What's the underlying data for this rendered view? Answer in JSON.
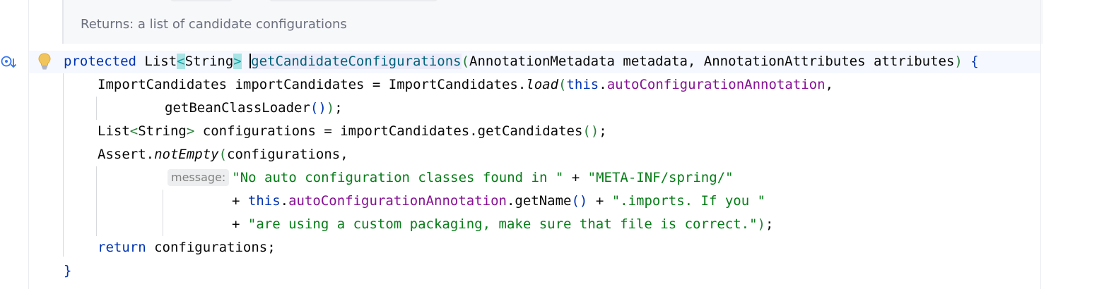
{
  "doc": {
    "returns_label": "Returns:",
    "returns_text": "a list of candidate configurations"
  },
  "gutter": {
    "implementations_icon": "implemented-methods-icon",
    "intention_icon": "lightbulb-icon"
  },
  "code": {
    "l1_kw": "protected",
    "l1_type": "List",
    "l1_lt": "<",
    "l1_generic": "String",
    "l1_gt": ">",
    "l1_method": "getCandidateConfigurations",
    "l1_open": "(",
    "l1_params": "AnnotationMetadata metadata, AnnotationAttributes attributes",
    "l1_close": ")",
    "l1_brace": "{",
    "l2_pre": "ImportCandidates importCandidates = ImportCandidates.",
    "l2_call": "load",
    "l2_open": "(",
    "l2_this": "this",
    "l2_dot": ".",
    "l2_field": "autoConfigurationAnnotation",
    "l2_comma": ",",
    "l3_call": "getBeanClassLoader",
    "l3_parens": "()",
    "l3_close": ")",
    "l3_semi": ";",
    "l4_type": "List",
    "l4_lt": "<",
    "l4_generic": "String",
    "l4_gt": ">",
    "l4_rest": " configurations = importCandidates.getCandidates",
    "l4_parens": "()",
    "l4_semi": ";",
    "l5_pre": "Assert.",
    "l5_call": "notEmpty",
    "l5_open": "(",
    "l5_arg": "configurations,",
    "l6_hint": "message:",
    "l6_str1": "\"No auto configuration classes found in \"",
    "l6_plus": " + ",
    "l6_str2": "\"META-INF/spring/\"",
    "l7_plus": "+ ",
    "l7_this": "this",
    "l7_dot": ".",
    "l7_field": "autoConfigurationAnnotation",
    "l7_call": ".getName",
    "l7_parens": "()",
    "l7_plus2": " + ",
    "l7_str": "\".imports. If you \"",
    "l8_plus": "+ ",
    "l8_str": "\"are using a custom packaging, make sure that file is correct.\"",
    "l8_close": ")",
    "l8_semi": ";",
    "l9_kw": "return",
    "l9_rest": " configurations;",
    "l10_brace": "}"
  }
}
